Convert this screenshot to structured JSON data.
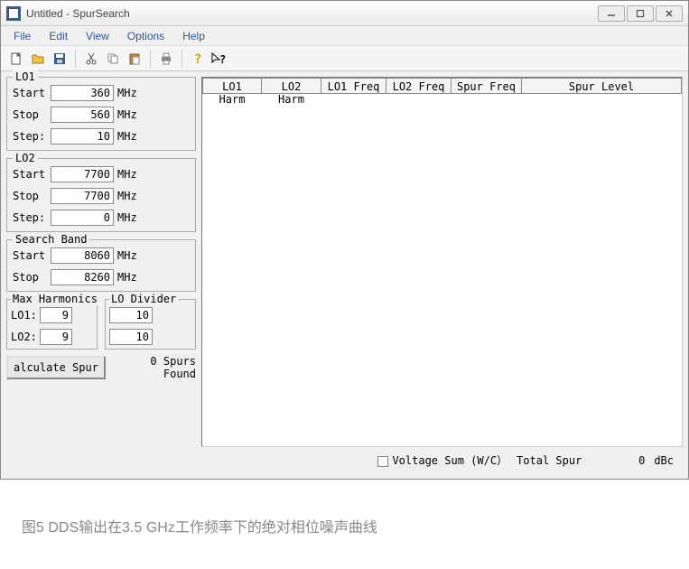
{
  "title": "Untitled - SpurSearch",
  "menu": {
    "file": "File",
    "edit": "Edit",
    "view": "View",
    "options": "Options",
    "help": "Help"
  },
  "lo1": {
    "legend": "LO1",
    "start_lbl": "Start",
    "start_val": "360",
    "start_unit": "MHz",
    "stop_lbl": "Stop",
    "stop_val": "560",
    "stop_unit": "MHz",
    "step_lbl": "Step:",
    "step_val": "10",
    "step_unit": "MHz"
  },
  "lo2": {
    "legend": "LO2",
    "start_lbl": "Start",
    "start_val": "7700",
    "start_unit": "MHz",
    "stop_lbl": "Stop",
    "stop_val": "7700",
    "stop_unit": "MHz",
    "step_lbl": "Step:",
    "step_val": "0",
    "step_unit": "MHz"
  },
  "searchband": {
    "legend": "Search Band",
    "start_lbl": "Start",
    "start_val": "8060",
    "start_unit": "MHz",
    "stop_lbl": "Stop",
    "stop_val": "8260",
    "stop_unit": "MHz"
  },
  "maxharm": {
    "legend": "Max Harmonics",
    "lo1_lbl": "LO1:",
    "lo1_val": "9",
    "lo2_lbl": "LO2:",
    "lo2_val": "9"
  },
  "lodiv": {
    "legend": "LO Divider",
    "v1": "10",
    "v2": "10"
  },
  "calc_btn": "alculate Spur",
  "spurs_found_n": "0 Spurs",
  "spurs_found_t": "Found",
  "thead": {
    "c1": "LO1 Harm",
    "c2": "LO2 Harm",
    "c3": "LO1 Freq",
    "c4": "LO2 Freq",
    "c5": "Spur Freq",
    "c6": "Spur Level"
  },
  "status": {
    "voltage_sum": "Voltage Sum (W/C）",
    "total_spur_lbl": "Total Spur",
    "total_spur_val": "0",
    "total_spur_unit": "dBc"
  },
  "caption": "图5 DDS输出在3.5 GHz工作频率下的绝对相位噪声曲线"
}
